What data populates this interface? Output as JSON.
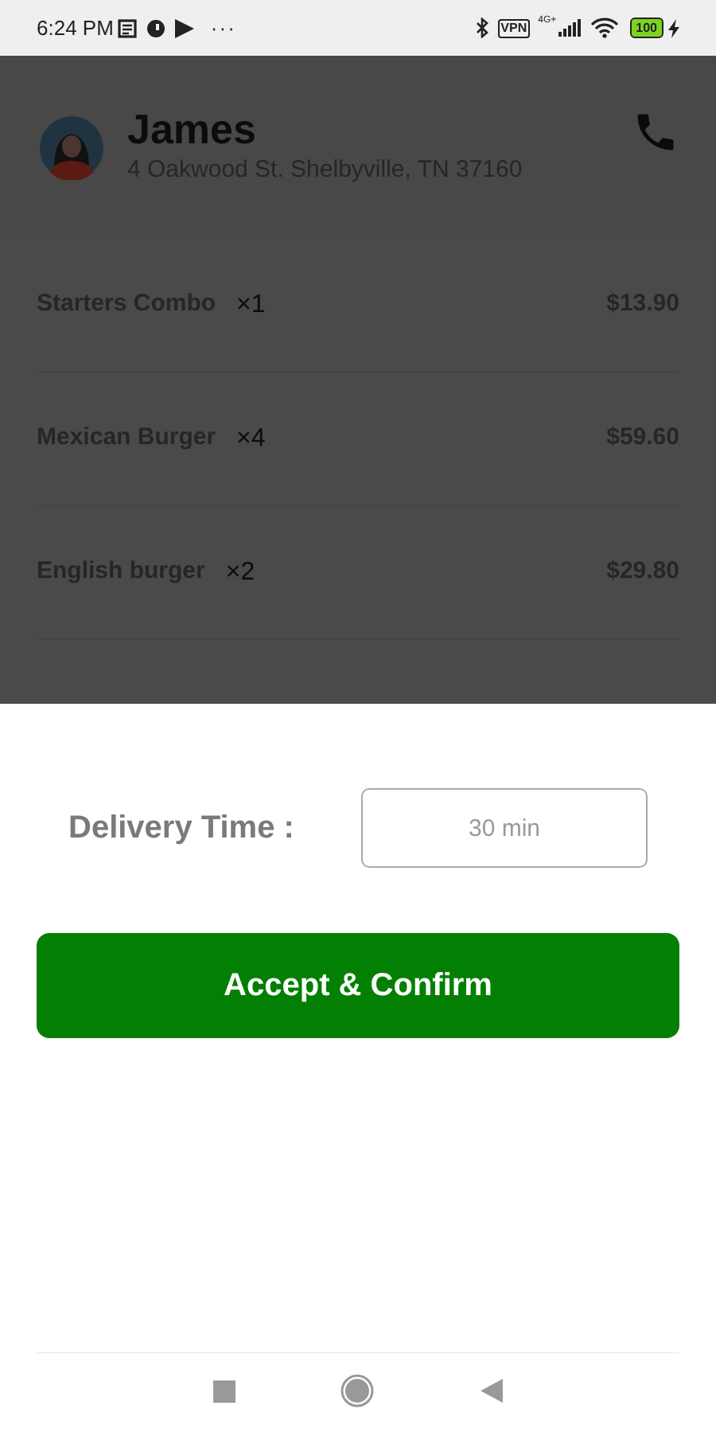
{
  "status_bar": {
    "time": "6:24 PM",
    "more": "···",
    "vpn": "VPN",
    "network": "4G+",
    "battery": "100"
  },
  "customer": {
    "name": "James",
    "address": "4 Oakwood St. Shelbyville, TN 37160"
  },
  "order_items": [
    {
      "name": "Starters Combo",
      "quantity": "×1",
      "price": "$13.90"
    },
    {
      "name": "Mexican Burger",
      "quantity": "×4",
      "price": "$59.60"
    },
    {
      "name": "English burger",
      "quantity": "×2",
      "price": "$29.80"
    }
  ],
  "delivery": {
    "label": "Delivery Time :",
    "placeholder": "30 min"
  },
  "confirm_button": "Accept & Confirm"
}
